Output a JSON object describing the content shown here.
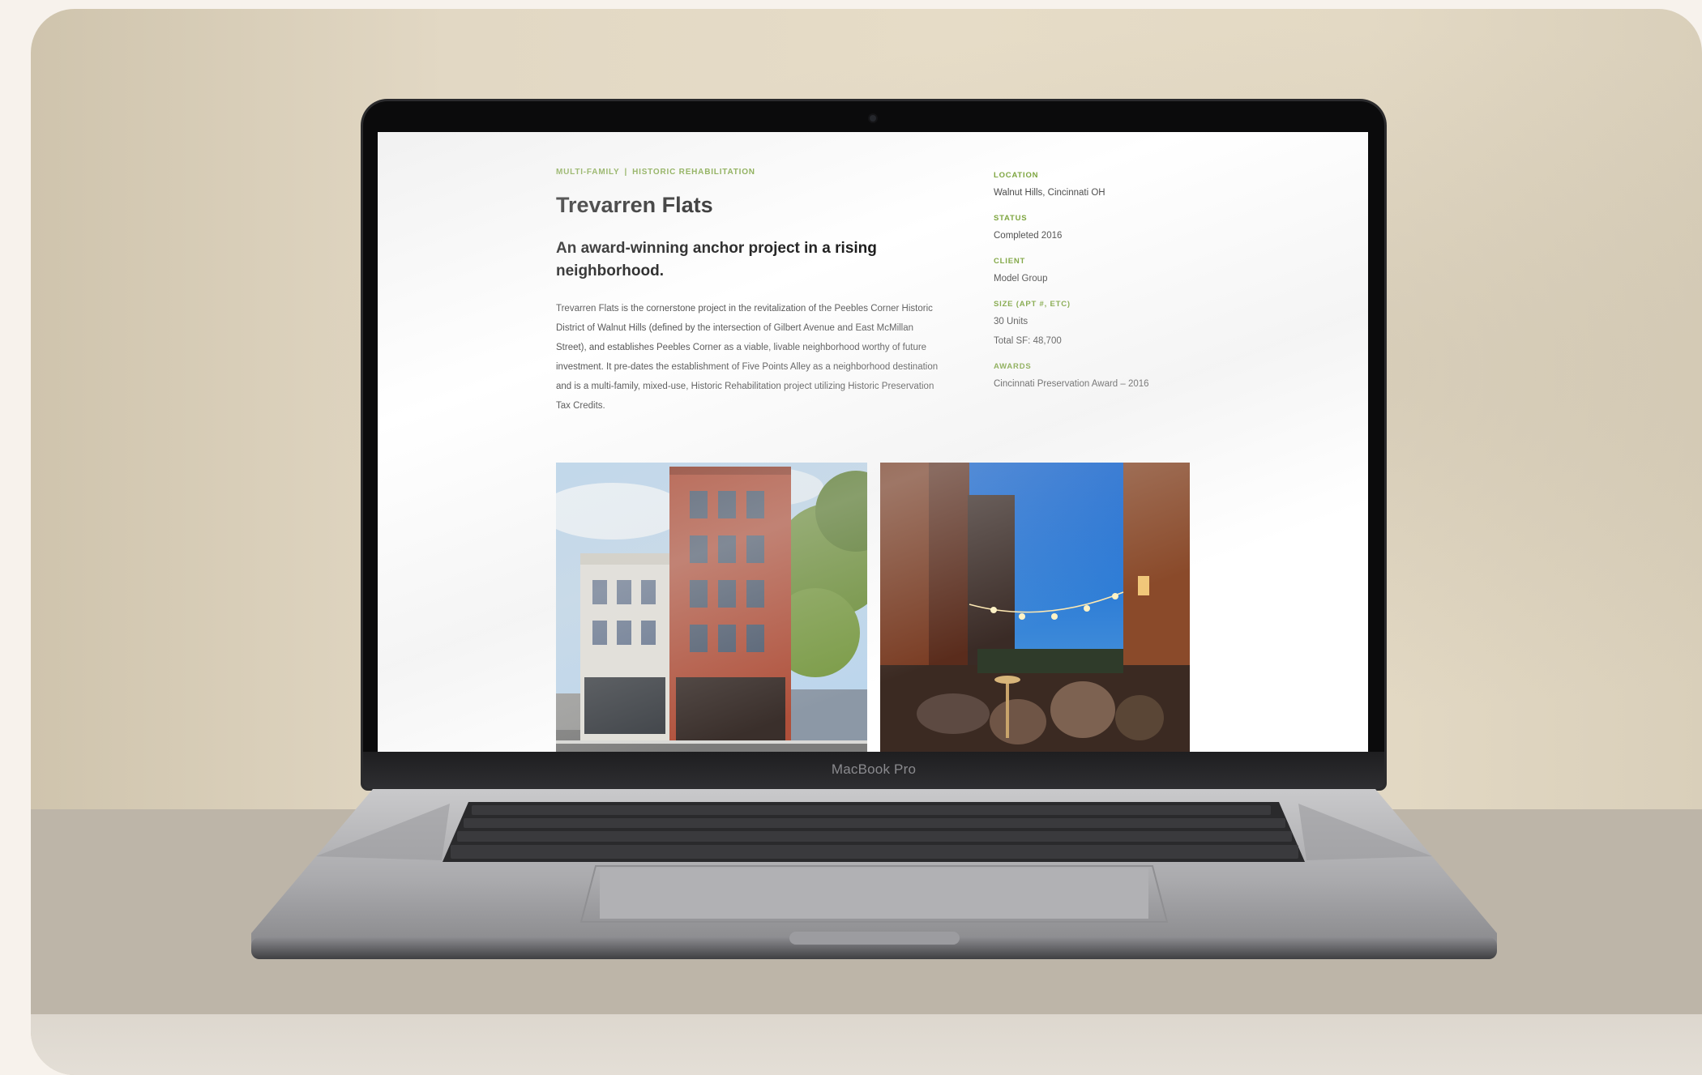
{
  "device": {
    "brand_label": "MacBook Pro"
  },
  "project": {
    "category_primary": "MULTI-FAMILY",
    "category_separator": "|",
    "category_secondary": "HISTORIC REHABILITATION",
    "title": "Trevarren Flats",
    "subtitle": "An award-winning anchor project in a rising neighborhood.",
    "description": "Trevarren Flats is the cornerstone project in the revitalization of the Peebles Corner Historic District of Walnut Hills (defined by the intersection of Gilbert Avenue and East McMillan Street), and establishes Peebles Corner as a viable, livable neighborhood worthy of future investment. It pre-dates the establishment of Five Points Alley as a neighborhood destination and is a multi-family, mixed-use, Historic Rehabilitation project utilizing Historic Preservation Tax Credits."
  },
  "details": {
    "location_label": "LOCATION",
    "location_value": "Walnut Hills, Cincinnati OH",
    "status_label": "STATUS",
    "status_value": "Completed 2016",
    "client_label": "CLIENT",
    "client_value": "Model Group",
    "size_label": "SIZE (APT #, ETC)",
    "size_units": "30 Units",
    "size_sf": "Total SF: 48,700",
    "awards_label": "AWARDS",
    "awards_value": "Cincinnati Preservation Award – 2016"
  },
  "colors": {
    "accent": "#7aa33a",
    "text": "#1c1c1c",
    "body": "#555555"
  },
  "images": [
    {
      "name": "building-exterior-photo"
    },
    {
      "name": "alley-patio-night-photo"
    }
  ]
}
